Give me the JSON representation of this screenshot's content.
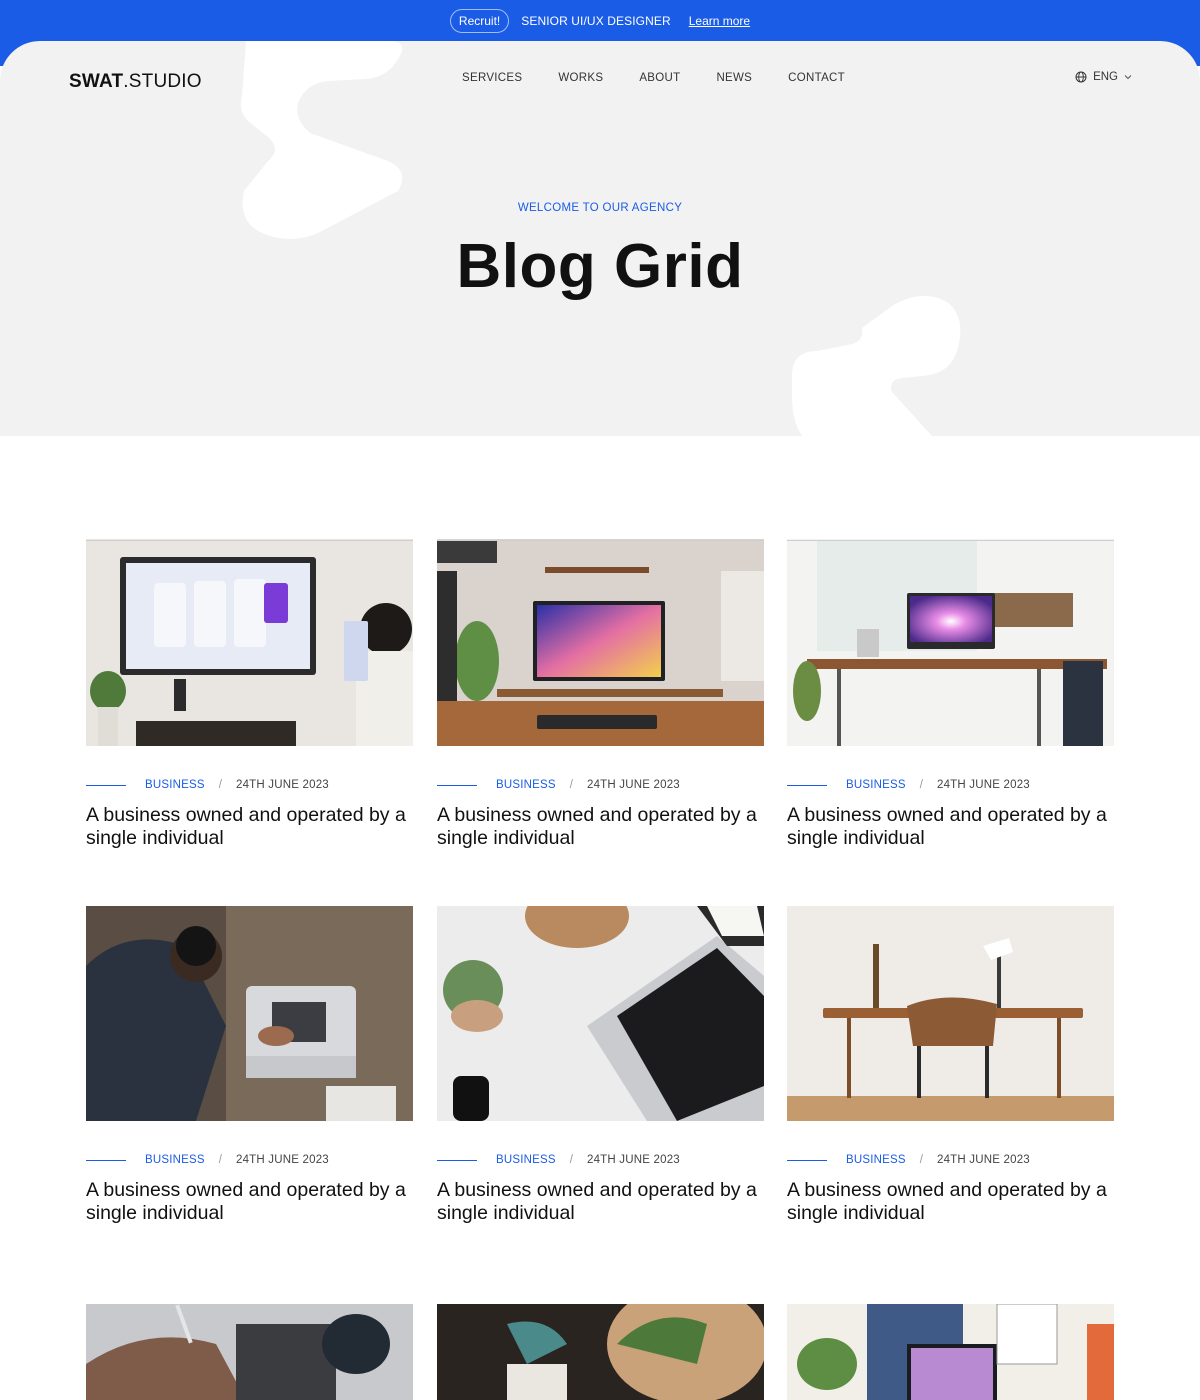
{
  "announcement": {
    "badge": "Recruit!",
    "title": "SENIOR UI/UX DESIGNER",
    "link": "Learn more"
  },
  "brand": {
    "name_strong": "SWAT",
    "name_light": ".STUDIO"
  },
  "nav": {
    "items": [
      "SERVICES",
      "WORKS",
      "ABOUT",
      "NEWS",
      "CONTACT"
    ]
  },
  "language": {
    "selected": "ENG"
  },
  "hero": {
    "eyebrow": "WELCOME TO OUR AGENCY",
    "title": "Blog Grid"
  },
  "posts": [
    {
      "category": "BUSINESS",
      "sep": "/",
      "date": "24TH JUNE 2023",
      "title": "A business owned and operated by a single individual"
    },
    {
      "category": "BUSINESS",
      "sep": "/",
      "date": "24TH JUNE 2023",
      "title": "A business owned and operated by a single individual"
    },
    {
      "category": "BUSINESS",
      "sep": "/",
      "date": "24TH JUNE 2023",
      "title": "A business owned and operated by a single individual"
    },
    {
      "category": "BUSINESS",
      "sep": "/",
      "date": "24TH JUNE 2023",
      "title": "A business owned and operated by a single individual"
    },
    {
      "category": "BUSINESS",
      "sep": "/",
      "date": "24TH JUNE 2023",
      "title": "A business owned and operated by a single individual"
    },
    {
      "category": "BUSINESS",
      "sep": "/",
      "date": "24TH JUNE 2023",
      "title": "A business owned and operated by a single individual"
    }
  ],
  "colors": {
    "accent": "#1a5ce6",
    "hero_bg": "#f2f2f3",
    "text": "#111111"
  }
}
